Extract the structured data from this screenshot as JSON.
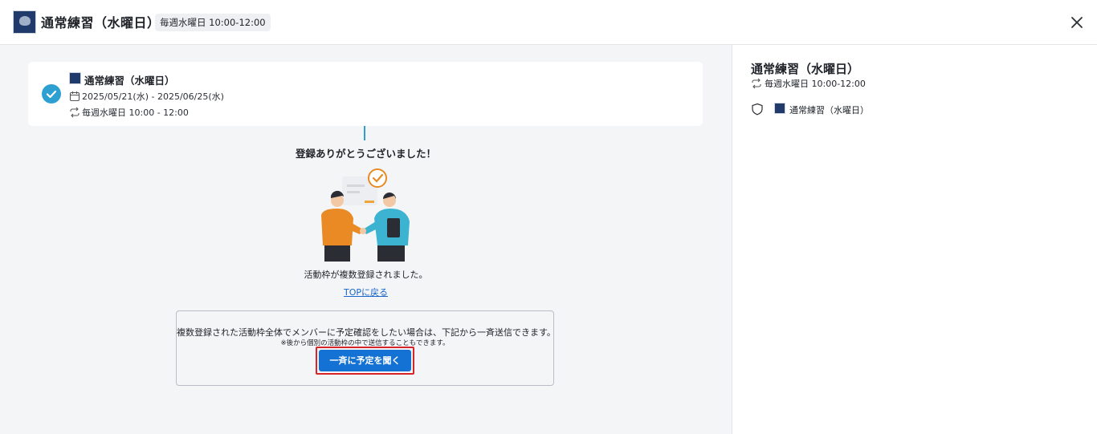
{
  "header": {
    "title": "通常練習（水曜日）",
    "schedule_badge": "毎週水曜日 10:00-12:00"
  },
  "card": {
    "title": "通常練習（水曜日）",
    "date_range": "2025/05/21(水) - 2025/06/25(水)",
    "recurrence": "毎週水曜日 10:00 - 12:00"
  },
  "main": {
    "thanks": "登録ありがとうございました！",
    "registered_message": "活動枠が複数登録されました。",
    "top_link": "TOPに戻る"
  },
  "notice": {
    "message": "複数登録された活動枠全体でメンバーに予定確認をしたい場合は、下記から一斉送信できます。",
    "sub_message": "※後から個別の活動枠の中で送信することもできます。",
    "button_label": "一斉に予定を聞く"
  },
  "sidebar": {
    "title": "通常練習（水曜日）",
    "recurrence": "毎週水曜日 10:00-12:00",
    "team_name": "通常練習（水曜日）"
  },
  "colors": {
    "accent": "#2d9fd1",
    "button": "#1572d5",
    "highlight_border": "#d6252a",
    "link": "#1a66c9"
  },
  "icons": [
    "team-logo-icon",
    "close-icon",
    "check-circle-icon",
    "calendar-icon",
    "repeat-icon",
    "shield-icon"
  ]
}
